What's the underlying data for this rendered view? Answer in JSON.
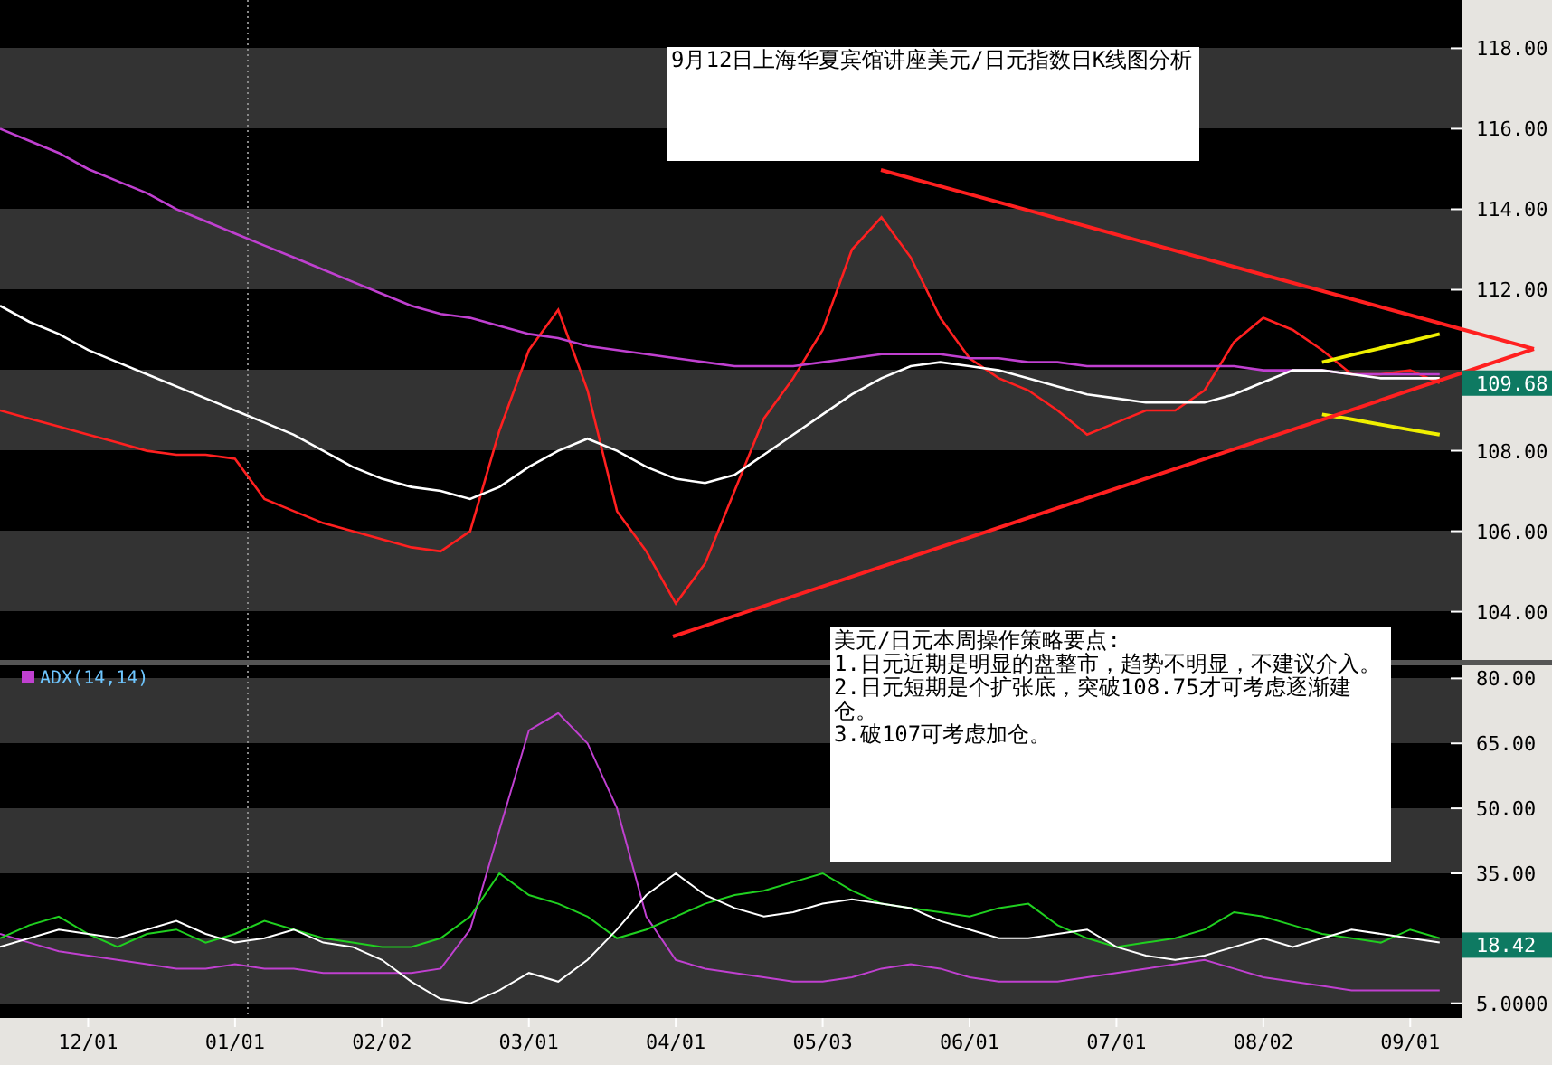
{
  "price_panel": {
    "chart_data": {
      "type": "line",
      "ylim": [
        102.8,
        119.2
      ],
      "yticks": [
        {
          "value": 104,
          "label": "104.00"
        },
        {
          "value": 106,
          "label": "106.00"
        },
        {
          "value": 108,
          "label": "108.00"
        },
        {
          "value": 112,
          "label": "112.00"
        },
        {
          "value": 114,
          "label": "114.00"
        },
        {
          "value": 116,
          "label": "116.00"
        },
        {
          "value": 118,
          "label": "118.00"
        }
      ],
      "series": [
        {
          "color": "#ff2020",
          "values": [
            109.0,
            108.8,
            108.6,
            108.4,
            108.2,
            108.0,
            107.9,
            107.9,
            107.8,
            106.8,
            106.5,
            106.2,
            106.0,
            105.8,
            105.6,
            105.5,
            106.0,
            108.5,
            110.5,
            111.5,
            109.5,
            106.5,
            105.5,
            104.2,
            105.2,
            107.0,
            108.8,
            109.8,
            111.0,
            113.0,
            113.8,
            112.8,
            111.3,
            110.3,
            109.8,
            109.5,
            109.0,
            108.4,
            108.7,
            109.0,
            109.0,
            109.5,
            110.7,
            111.3,
            111.0,
            110.5,
            109.9,
            109.9,
            110.0,
            109.68
          ]
        },
        {
          "color": "#c040d0",
          "values": [
            116.0,
            115.7,
            115.4,
            115.0,
            114.7,
            114.4,
            114.0,
            113.7,
            113.4,
            113.1,
            112.8,
            112.5,
            112.2,
            111.9,
            111.6,
            111.4,
            111.3,
            111.1,
            110.9,
            110.8,
            110.6,
            110.5,
            110.4,
            110.3,
            110.2,
            110.1,
            110.1,
            110.1,
            110.2,
            110.3,
            110.4,
            110.4,
            110.4,
            110.3,
            110.3,
            110.2,
            110.2,
            110.1,
            110.1,
            110.1,
            110.1,
            110.1,
            110.1,
            110.0,
            110.0,
            110.0,
            109.9,
            109.9,
            109.9,
            109.9
          ]
        },
        {
          "color": "#f0f000",
          "values": [
            null,
            null,
            null,
            null,
            null,
            null,
            null,
            null,
            null,
            null,
            null,
            null,
            null,
            null,
            null,
            null,
            null,
            null,
            null,
            null,
            null,
            null,
            null,
            null,
            null,
            null,
            null,
            null,
            null,
            null,
            null,
            null,
            null,
            null,
            null,
            null,
            null,
            null,
            null,
            null,
            null,
            null,
            null,
            null,
            null,
            110.2,
            110.38,
            110.55,
            110.72,
            110.9
          ]
        },
        {
          "color": "#f0f000",
          "values": [
            null,
            null,
            null,
            null,
            null,
            null,
            null,
            null,
            null,
            null,
            null,
            null,
            null,
            null,
            null,
            null,
            null,
            null,
            null,
            null,
            null,
            null,
            null,
            null,
            null,
            null,
            null,
            null,
            null,
            null,
            null,
            null,
            null,
            null,
            null,
            null,
            null,
            null,
            null,
            null,
            null,
            null,
            null,
            null,
            null,
            108.9,
            108.78,
            108.65,
            108.52,
            108.4
          ]
        },
        {
          "color": "#ffffff",
          "values": [
            111.6,
            111.2,
            110.9,
            110.5,
            110.2,
            109.9,
            109.6,
            109.3,
            109.0,
            108.7,
            108.4,
            108.0,
            107.6,
            107.3,
            107.1,
            107.0,
            106.8,
            107.1,
            107.6,
            108.0,
            108.3,
            108.0,
            107.6,
            107.3,
            107.2,
            107.4,
            107.9,
            108.4,
            108.9,
            109.4,
            109.8,
            110.1,
            110.2,
            110.1,
            110.0,
            109.8,
            109.6,
            109.4,
            109.3,
            109.2,
            109.2,
            109.2,
            109.4,
            109.7,
            110.0,
            110.0,
            109.9,
            109.8,
            109.8,
            109.8
          ]
        }
      ]
    },
    "last_value": "109.68"
  },
  "adx_panel": {
    "chart_data": {
      "type": "line",
      "title": "ADX(14,14)",
      "ylim": [
        1.6,
        83
      ],
      "categories": [
        null,
        null,
        null,
        "12/01",
        null,
        null,
        null,
        null,
        "01/01",
        null,
        null,
        null,
        null,
        "02/02",
        null,
        null,
        null,
        null,
        "03/01",
        null,
        null,
        null,
        null,
        "04/01",
        null,
        null,
        null,
        null,
        "05/03",
        null,
        null,
        null,
        null,
        "06/01",
        null,
        null,
        null,
        null,
        "07/01",
        null,
        null,
        null,
        null,
        "08/02",
        null,
        null,
        null,
        null,
        "09/01",
        null
      ],
      "yticks": [
        {
          "value": 5,
          "label": "5.0000"
        },
        {
          "value": 35,
          "label": "35.00"
        },
        {
          "value": 50,
          "label": "50.00"
        },
        {
          "value": 65,
          "label": "65.00"
        },
        {
          "value": 80,
          "label": "80.00"
        }
      ],
      "series": [
        {
          "color": "#c040d0",
          "values": [
            21,
            19,
            17,
            16,
            15,
            14,
            13,
            13,
            14,
            13,
            13,
            12,
            12,
            12,
            12,
            13,
            22,
            45,
            68,
            72,
            65,
            50,
            25,
            15,
            13,
            12,
            11,
            10,
            10,
            11,
            13,
            14,
            13,
            11,
            10,
            10,
            10,
            11,
            12,
            13,
            14,
            15,
            13,
            11,
            10,
            9,
            8,
            8,
            8,
            8
          ]
        },
        {
          "color": "#20d020",
          "values": [
            20,
            23,
            25,
            21,
            18,
            21,
            22,
            19,
            21,
            24,
            22,
            20,
            19,
            18,
            18,
            20,
            25,
            35,
            30,
            28,
            25,
            20,
            22,
            25,
            28,
            30,
            31,
            33,
            35,
            31,
            28,
            27,
            26,
            25,
            27,
            28,
            23,
            20,
            18,
            19,
            20,
            22,
            26,
            25,
            23,
            21,
            20,
            19,
            22,
            20
          ]
        },
        {
          "color": "#ffffff",
          "values": [
            18,
            20,
            22,
            21,
            20,
            22,
            24,
            21,
            19,
            20,
            22,
            19,
            18,
            15,
            10,
            6,
            5,
            8,
            12,
            10,
            15,
            22,
            30,
            35,
            30,
            27,
            25,
            26,
            28,
            29,
            28,
            27,
            24,
            22,
            20,
            20,
            21,
            22,
            18,
            16,
            15,
            16,
            18,
            20,
            18,
            20,
            22,
            21,
            20,
            19
          ]
        }
      ]
    },
    "last_value": "18.42"
  },
  "notes": [
    {
      "text": "9月12日上海华夏宾馆讲座美元/日元指数日K线图分析"
    },
    {
      "text": "美元/日元本周操作策略要点:\n1.日元近期是明显的盘整市，趋势不明显，不建议介入。\n2.日元短期是个扩张底，突破108.75才可考虑逐渐建仓。\n3.破107可考虑加仓。"
    }
  ]
}
